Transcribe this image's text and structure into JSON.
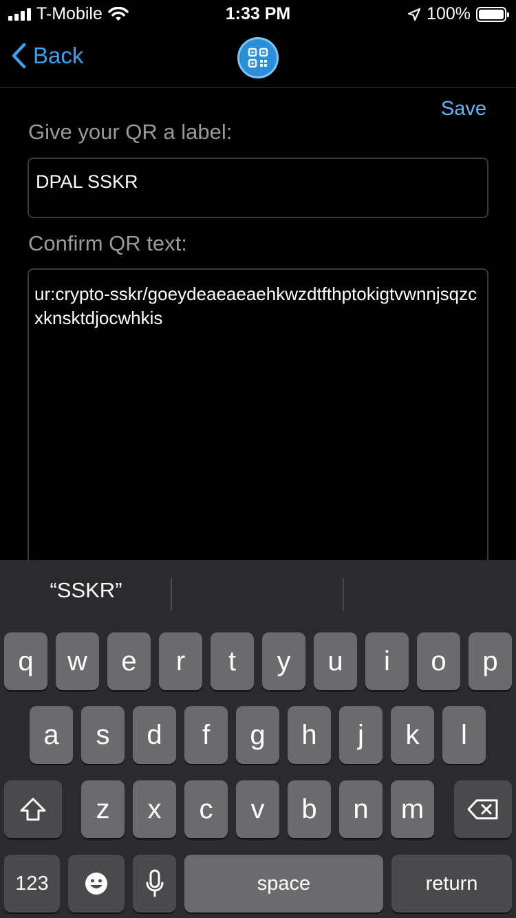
{
  "status_bar": {
    "carrier": "T-Mobile",
    "time": "1:33 PM",
    "battery": "100%"
  },
  "nav": {
    "back_label": "Back"
  },
  "form": {
    "save_label": "Save",
    "label_title": "Give your QR a label:",
    "label_value": "DPAL SSKR",
    "text_title": "Confirm QR text:",
    "text_value": "ur:crypto-sskr/goeydeaeaeaehkwzdtfthptokigtvwnnjsqzcxknsktdjocwhkis"
  },
  "keyboard": {
    "suggestions": [
      "“SSKR”",
      "",
      ""
    ],
    "row1": [
      "q",
      "w",
      "e",
      "r",
      "t",
      "y",
      "u",
      "i",
      "o",
      "p"
    ],
    "row2": [
      "a",
      "s",
      "d",
      "f",
      "g",
      "h",
      "j",
      "k",
      "l"
    ],
    "row3": [
      "z",
      "x",
      "c",
      "v",
      "b",
      "n",
      "m"
    ],
    "numbers_label": "123",
    "space_label": "space",
    "return_label": "return"
  },
  "colors": {
    "accent": "#3aa0f0",
    "key": "#6b6b6e",
    "key_dark": "#4a4a4c",
    "keyboard_bg": "#2b2b2d"
  }
}
